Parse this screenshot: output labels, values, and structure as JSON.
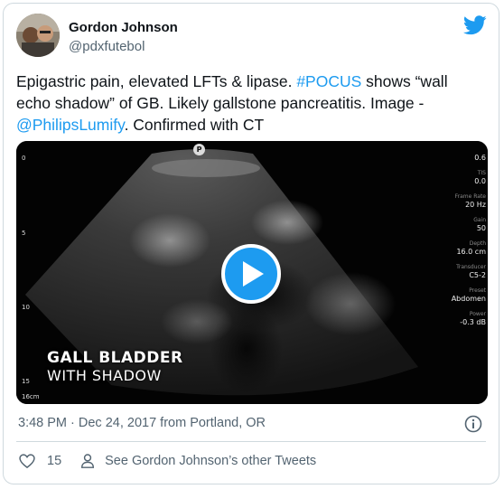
{
  "author": {
    "display_name": "Gordon Johnson",
    "handle": "@pdxfutebol"
  },
  "tweet": {
    "text_1": "Epigastric pain, elevated LFTs & lipase. ",
    "hashtag": "#POCUS",
    "text_2": " shows “wall echo shadow” of GB. Likely gallstone pancreatitis. Image - ",
    "mention": "@PhilipsLumify",
    "text_3": ". Confirmed with CT"
  },
  "media": {
    "label_line_1": "GALL BLADDER",
    "label_line_2": "WITH SHADOW",
    "probe_marker": "P",
    "depth_ticks": [
      "0",
      "5",
      "10",
      "15",
      "16cm"
    ],
    "panel": [
      {
        "label": "",
        "value": "0.6"
      },
      {
        "label": "TIS",
        "value": "0.0"
      },
      {
        "label": "Frame Rate",
        "value": "20 Hz"
      },
      {
        "label": "Gain",
        "value": "50"
      },
      {
        "label": "Depth",
        "value": "16.0 cm"
      },
      {
        "label": "Transducer",
        "value": "C5-2"
      },
      {
        "label": "Preset",
        "value": "Abdomen"
      },
      {
        "label": "Power",
        "value": "-0.3 dB"
      }
    ]
  },
  "meta": {
    "timestamp": "3:48 PM · Dec 24, 2017 from Portland, OR"
  },
  "actions": {
    "like_count": "15",
    "other_tweets_label": "See Gordon Johnson’s other Tweets"
  },
  "colors": {
    "accent": "#1d9bf0",
    "text_primary": "#0f1419",
    "text_secondary": "#536471",
    "border": "#cfd9de"
  },
  "icons": [
    "twitter-bird-icon",
    "play-icon",
    "info-icon",
    "heart-icon",
    "person-icon"
  ]
}
